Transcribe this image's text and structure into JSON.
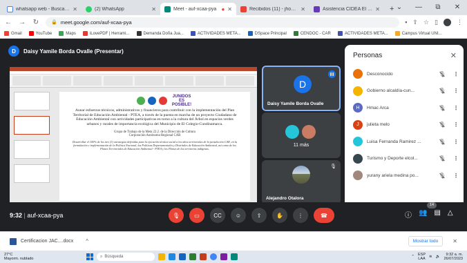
{
  "browser": {
    "tabs": [
      {
        "title": "whatsapp web - Buscar con",
        "color": "#ffffff",
        "active": false
      },
      {
        "title": "(2) WhatsApp",
        "color": "#25d366",
        "active": false
      },
      {
        "title": "Meet - auf-xcaa-pya",
        "color": "#00897b",
        "active": true
      },
      {
        "title": "Recibidos (11) - jhonatabo",
        "color": "#ea4335",
        "active": false
      },
      {
        "title": "Asistencia CIDEA El Colegio",
        "color": "#673ab7",
        "active": false
      }
    ],
    "new_tab": "+",
    "window_controls": [
      "⌄",
      "—",
      "⧉",
      "✕"
    ],
    "url": "meet.google.com/auf-xcaa-pya",
    "bookmarks": [
      {
        "label": "Gmail",
        "color": "#ea4335"
      },
      {
        "label": "YouTube",
        "color": "#ff0000"
      },
      {
        "label": "Maps",
        "color": "#34a853"
      },
      {
        "label": "iLovePDF | Herrami...",
        "color": "#e53935"
      },
      {
        "label": "Demanda Doña Jua...",
        "color": "#333333"
      },
      {
        "label": "ACTIVIDADES META...",
        "color": "#3f51b5"
      },
      {
        "label": "DSpace Principal",
        "color": "#1565c0"
      },
      {
        "label": "CENDOC - CAR",
        "color": "#2e7d32"
      },
      {
        "label": "ACTIVIDADES META...",
        "color": "#3f51b5"
      },
      {
        "label": "Campus Virtual UNI...",
        "color": "#f9a825"
      }
    ]
  },
  "meet": {
    "presenter_initial": "D",
    "presenter_label": "Daisy Yamile Borda Ovalle (Presentar)",
    "slide": {
      "logo_text": "JUNIDOS ES POSIBLE!",
      "main_text": "Aunar esfuerzos técnicos, administrativos y financieros para contribuir con la implementación del Plan Territorial de Educación Ambiental - PTEA, a través de la puesta en marcha de un proyecto Ciudadano de Educación Ambiental con actividades participativas en torno a la cultura del Árbol en espacios verdes urbanos y rurales de importancia ecológica del Municipio de El Colegio-Cundinamarca.",
      "group_text": "Grupo de Trabajo de la Meta 22.2. de la Dirección de Cultura",
      "corp_text": "Corporación Autónoma Regional CAR",
      "footer_text": "Desarrollar el 100% de los tres (3) estrategias definidas para la ejecución técnica social a los años territoriales de la jurisdicción CAR, en la formulación e implementación de la Política Nacional, las Políticas Departamentales y Distritales de Educación Ambiental, así como de los Planes Territoriales de Educación Ambiental - PTEA y los Planes de los territorios indígenas."
    },
    "tiles": {
      "daisy": {
        "initial": "D",
        "name": "Daisy Yamile Borda Ovalle"
      },
      "more": {
        "label": "11 más"
      },
      "alejandro": {
        "name": "Alejandro Otalora"
      }
    },
    "people_panel": {
      "title": "Personas",
      "close": "✕",
      "people": [
        {
          "name": "Desconocido",
          "initial": "",
          "color": "#e8710a"
        },
        {
          "name": "Gobierno alcaldía-cun...",
          "initial": "",
          "color": "#f4b400"
        },
        {
          "name": "Hmac Arca",
          "initial": "H",
          "color": "#5c6bc0"
        },
        {
          "name": "julieta melo",
          "initial": "J",
          "color": "#d84315"
        },
        {
          "name": "Luisa Fernanda Ramirez ...",
          "initial": "",
          "color": "#26c6da"
        },
        {
          "name": "Turismo y Deporte elcol...",
          "initial": "",
          "color": "#37474f"
        },
        {
          "name": "yurany ariela medina po...",
          "initial": "",
          "color": "#a1887f"
        }
      ]
    },
    "meeting_time": "9:32",
    "meeting_code": "auf-xcaa-pya",
    "participant_count": "14"
  },
  "downloads": {
    "file": "Certificacion JAC....docx",
    "show_all": "Mostrar todo",
    "chevron": "^",
    "close": "✕"
  },
  "taskbar": {
    "temp": "27°C",
    "weather": "Mayorm. nublado",
    "search": "Búsqueda",
    "lang": "ESP",
    "lang_sub": "LAA",
    "time": "9:32 a. m.",
    "date": "26/07/2023"
  }
}
